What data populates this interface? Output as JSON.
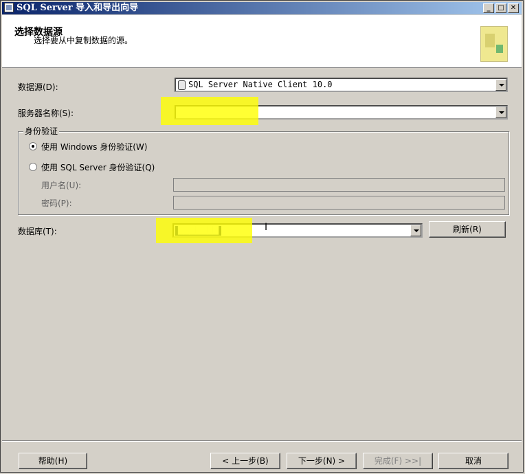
{
  "window": {
    "title": "SQL Server 导入和导出向导",
    "minimize": "_",
    "maximize": "□",
    "close": "✕"
  },
  "header": {
    "title": "选择数据源",
    "subtitle": "选择要从中复制数据的源。"
  },
  "form": {
    "datasource_label": "数据源(D):",
    "datasource_value": "SQL Server Native Client 10.0",
    "server_label": "服务器名称(S):",
    "server_value": "",
    "auth_group": {
      "title": "身份验证",
      "windows_auth": "使用 Windows 身份验证(W)",
      "sql_auth": "使用 SQL Server 身份验证(Q)",
      "username_label": "用户名(U):",
      "password_label": "密码(P):",
      "selected": "windows"
    },
    "database_label": "数据库(T):",
    "database_value": "███████",
    "refresh_button": "刷新(R)"
  },
  "footer": {
    "help": "帮助(H)",
    "back": "< 上一步(B)",
    "next": "下一步(N) >",
    "finish": "完成(F) >>|",
    "cancel": "取消"
  },
  "colors": {
    "highlight": "#ffff00",
    "titlebar_start": "#0a246a",
    "titlebar_end": "#a6caf0"
  }
}
